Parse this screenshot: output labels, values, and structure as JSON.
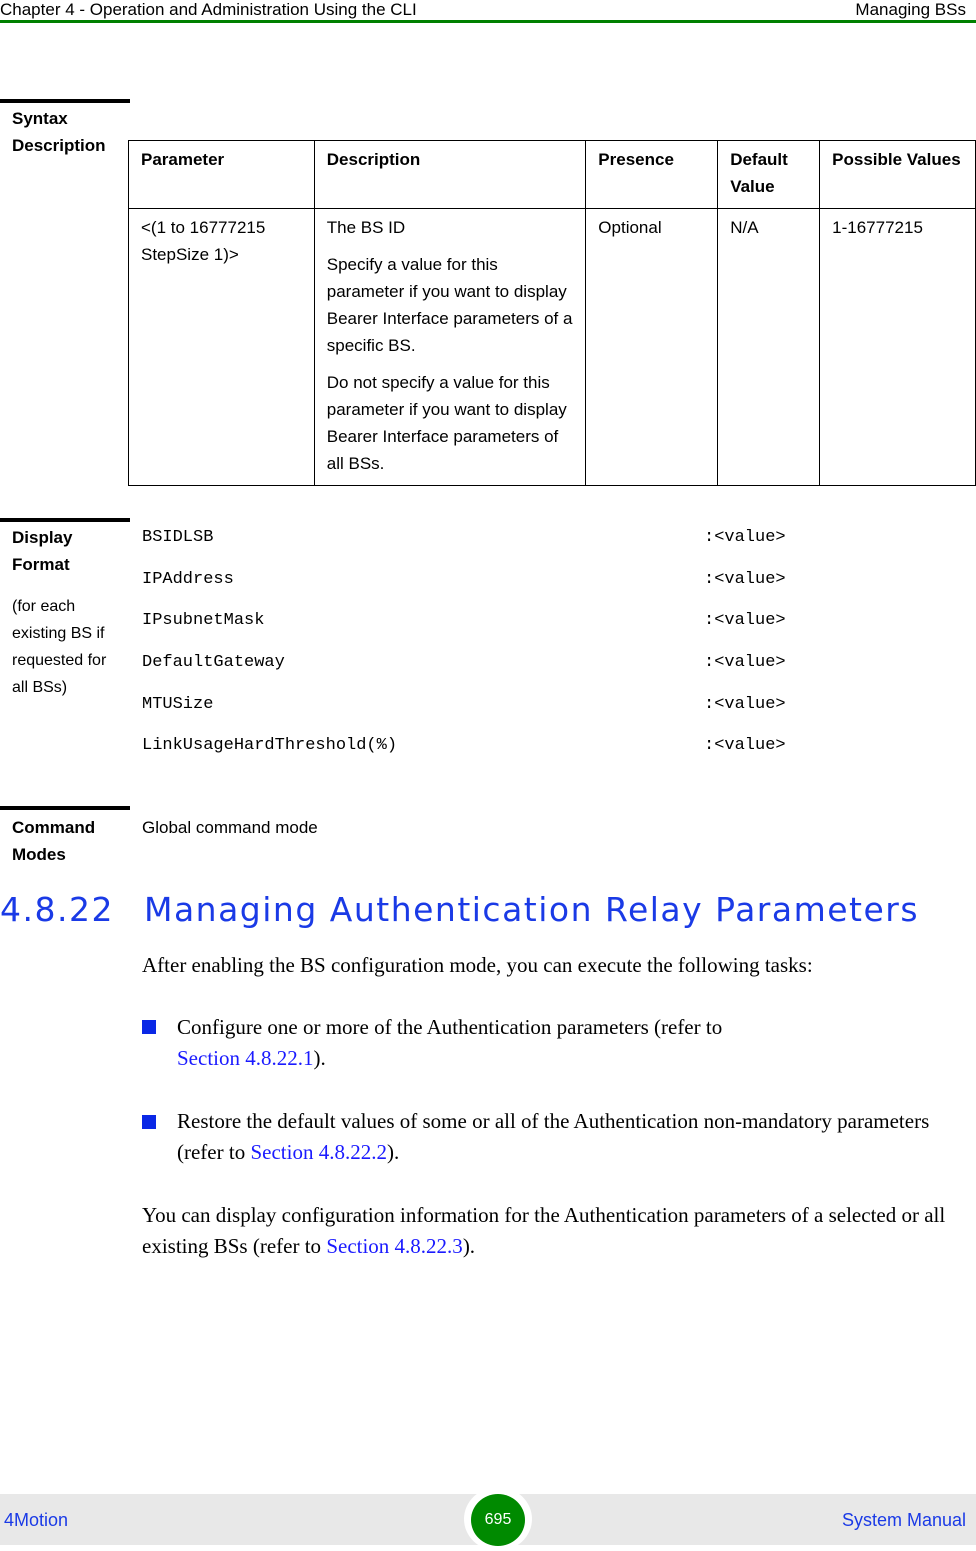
{
  "header": {
    "chapter_title": "Chapter 4 - Operation and Administration Using the CLI",
    "section_title": "Managing BSs"
  },
  "syntax_description": {
    "label_line1": "Syntax",
    "label_line2": "Description",
    "columns": [
      "Parameter",
      "Description",
      "Presence",
      "Default Value",
      "Possible Values"
    ],
    "rows": [
      {
        "parameter": "<(1 to 16777215 StepSize 1)>",
        "description_title": "The BS ID",
        "description_p1": "Specify a value for this parameter if you want to display Bearer Interface parameters of a specific BS.",
        "description_p2": "Do not specify a value for this parameter if you want to display Bearer Interface parameters of all BSs.",
        "presence": "Optional",
        "default_value": "N/A",
        "possible_values": "1-16777215"
      }
    ]
  },
  "display_format": {
    "label_line1": "Display",
    "label_line2": "Format",
    "note": "(for each existing BS if requested for all BSs)",
    "fields": [
      {
        "name": "BSIDLSB",
        "value": ":<value>"
      },
      {
        "name": "IPAddress",
        "value": ":<value>"
      },
      {
        "name": "IPsubnetMask",
        "value": ":<value>"
      },
      {
        "name": "DefaultGateway",
        "value": ":<value>"
      },
      {
        "name": "MTUSize",
        "value": ":<value>"
      },
      {
        "name": "LinkUsageHardThreshold(%)",
        "value": ":<value>"
      }
    ]
  },
  "command_modes": {
    "label_line1": "Command",
    "label_line2": "Modes",
    "value": "Global command mode"
  },
  "section": {
    "number": "4.8.22",
    "title": "Managing Authentication Relay Parameters",
    "intro": "After enabling the BS configuration mode, you can execute the following tasks:",
    "bullets": [
      {
        "text": "Configure one or more of the Authentication parameters (refer to ",
        "link": "Section 4.8.22.1",
        "tail": ")."
      },
      {
        "text": "Restore the default values of some or all of the Authentication non-mandatory parameters (refer to ",
        "link": "Section 4.8.22.2",
        "tail": ")."
      }
    ],
    "closing": {
      "text": "You can display configuration information for the Authentication parameters of a selected or all existing BSs (refer to ",
      "link": "Section 4.8.22.3",
      "tail": ")."
    }
  },
  "footer": {
    "product": "4Motion",
    "page_number": "695",
    "manual": "System Manual"
  },
  "colors": {
    "header_rule": "#008000",
    "heading_blue": "#1a3ae6",
    "link_blue": "#1a1aff",
    "page_badge": "#008a00"
  }
}
